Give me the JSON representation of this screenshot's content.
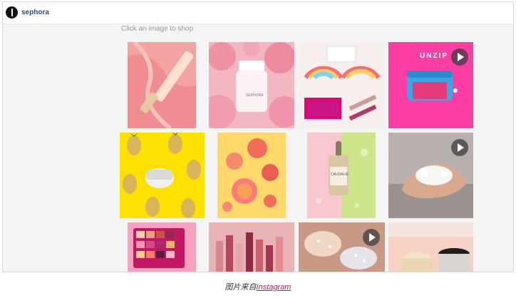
{
  "header": {
    "username": "sephora",
    "avatar_icon": "sephora-logo-icon"
  },
  "hint": "Click an image to shop",
  "grid": {
    "tiles": [
      {
        "name": "pink-gloss-tube-photo",
        "video": false
      },
      {
        "name": "roses-serum-bottle-photo",
        "video": false,
        "label": "SEPHORA"
      },
      {
        "name": "rainbow-palette-photo",
        "video": false
      },
      {
        "name": "unzip-pouch-photo",
        "video": true,
        "overlay_text": "UNZIP"
      },
      {
        "name": "pineapple-cream-jar-photo",
        "video": false
      },
      {
        "name": "peach-blush-compacts-photo",
        "video": false
      },
      {
        "name": "caudalie-serum-photo",
        "video": false,
        "label": "CAUDALIE"
      },
      {
        "name": "foam-hand-photo",
        "video": true
      },
      {
        "name": "eyeshadow-palette-photo",
        "video": false
      },
      {
        "name": "lipstick-collection-photo",
        "video": false
      },
      {
        "name": "glitter-swatch-photo",
        "video": true
      },
      {
        "name": "cream-jars-photo",
        "video": false
      }
    ]
  },
  "caption": {
    "prefix": "图片来自",
    "link_text": "Instagram"
  },
  "colors": {
    "link": "#c2185b",
    "username": "#1f4f80",
    "unzip_bg": "#ff3ea5"
  }
}
